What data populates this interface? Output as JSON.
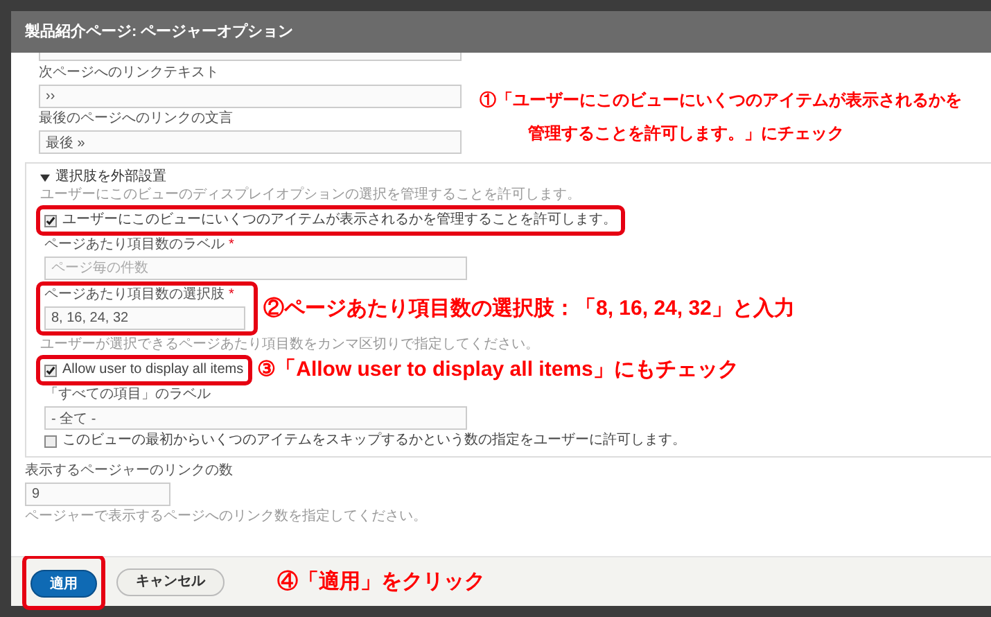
{
  "dialog_title": "製品紹介ページ: ページャーオプション",
  "link_fields": [
    {
      "label": "次ページへのリンクテキスト",
      "value": "››"
    },
    {
      "label": "最後のページへのリンクの文言",
      "value": "最後 »"
    }
  ],
  "callout_1": {
    "lines": [
      "①「ユーザーにこのビューにいくつのアイテムが表示されるかを",
      "管理することを許可します。」にチェック"
    ]
  },
  "exposed_section": {
    "legend": "選択肢を外部設置",
    "expanded": true,
    "description": "ユーザーにこのビューのディスプレイオプションの選択を管理することを許可します。",
    "items": [
      {
        "kind": "checkbox",
        "label": "ユーザーにこのビューにいくつのアイテムが表示されるかを管理することを許可します。",
        "checked": true,
        "highlighted": true
      },
      {
        "kind": "text",
        "label": "ページあたり項目数のラベル",
        "required_mark": "*",
        "placeholder": "ページ毎の件数",
        "highlighted": false
      },
      {
        "kind": "text",
        "label": "ページあたり項目数の選択肢",
        "required_mark": "*",
        "value": "8, 16, 24, 32",
        "highlighted": true,
        "callout": "②ページあたり項目数の選択肢：「8, 16, 24, 32」と入力",
        "description": "ユーザーが選択できるページあたり項目数をカンマ区切りで指定してください。"
      },
      {
        "kind": "checkbox",
        "label": "Allow user to display all items",
        "checked": true,
        "highlighted": true,
        "callout": "③「Allow user to display all items」にもチェック"
      },
      {
        "kind": "text",
        "label": "「すべての項目」のラベル",
        "value": "- 全て -",
        "highlighted": false
      },
      {
        "kind": "checkbox",
        "label": "このビューの最初からいくつのアイテムをスキップするかという数の指定をユーザーに許可します。",
        "checked": false,
        "highlighted": false
      }
    ]
  },
  "pager_links": {
    "label": "表示するページャーのリンクの数",
    "value": "9",
    "description": "ページャーで表示するページへのリンク数を指定してください。"
  },
  "buttons": [
    {
      "label": "適用",
      "kind": "primary",
      "highlighted": true
    },
    {
      "label": "キャンセル",
      "kind": "secondary",
      "highlighted": false
    }
  ],
  "footer_callout": "④「適用」をクリック"
}
